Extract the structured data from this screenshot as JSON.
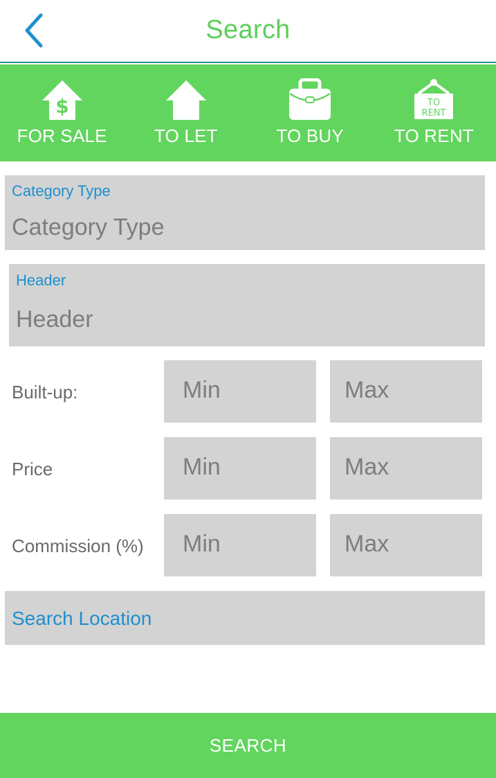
{
  "header": {
    "title": "Search",
    "back_icon": "chevron-left-icon"
  },
  "colors": {
    "accent_green": "#62d55e",
    "title_green": "#5ccf5a",
    "link_blue": "#1f8fcf",
    "field_gray": "#d3d3d3",
    "divider_teal": "#2a8fa2"
  },
  "categories": [
    {
      "label": "FOR SALE",
      "icon": "house-dollar-icon"
    },
    {
      "label": "TO LET",
      "icon": "house-icon"
    },
    {
      "label": "TO BUY",
      "icon": "briefcase-icon"
    },
    {
      "label": "TO RENT",
      "icon": "to-rent-sign-icon",
      "icon_text_line1": "TO",
      "icon_text_line2": "RENT"
    }
  ],
  "form": {
    "category_type": {
      "label": "Category Type",
      "placeholder": "Category Type"
    },
    "header": {
      "label": "Header",
      "placeholder": "Header"
    },
    "ranges": [
      {
        "label": "Built-up:",
        "min_placeholder": "Min",
        "max_placeholder": "Max"
      },
      {
        "label": "Price",
        "min_placeholder": "Min",
        "max_placeholder": "Max"
      },
      {
        "label": "Commission (%)",
        "min_placeholder": "Min",
        "max_placeholder": "Max"
      }
    ],
    "location": {
      "placeholder": "Search Location"
    }
  },
  "actions": {
    "search_label": "SEARCH"
  }
}
